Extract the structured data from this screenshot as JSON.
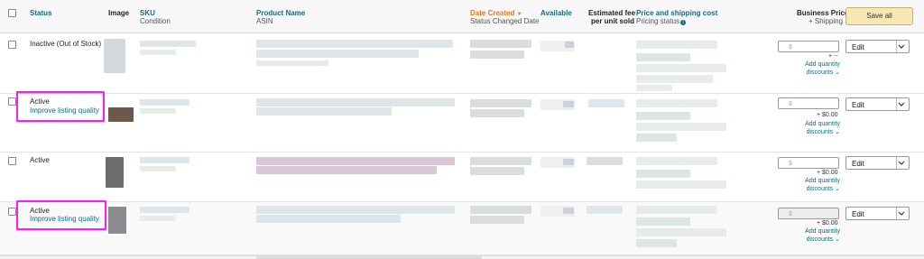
{
  "header": {
    "status": "Status",
    "image": "Image",
    "sku": "SKU",
    "condition": "Condition",
    "product_name": "Product Name",
    "asin": "ASIN",
    "date_created": "Date Created",
    "date_created_arrow": "▼",
    "status_changed_date": "Status Changed Date",
    "available": "Available",
    "est_fee_line1": "Estimated fee",
    "est_fee_line2": "per unit sold",
    "price_shipping": "Price and shipping cost",
    "pricing_status": "Pricing status",
    "pricing_status_info": "i",
    "business_price": "Business Price",
    "plus_shipping": "+ Shipping",
    "save_all": "Save all"
  },
  "rows": [
    {
      "status": "Inactive (Out of Stock)",
      "quality_link": "",
      "price_placeholder": "$",
      "shipping_text": "+ --",
      "add_discounts_line1": "Add quantity",
      "add_discounts_line2": "discounts ⌄",
      "action": "Edit"
    },
    {
      "status": "Active",
      "quality_link": "Improve listing quality",
      "price_placeholder": "$",
      "shipping_text": "+ $0.00",
      "add_discounts_line1": "Add quantity",
      "add_discounts_line2": "discounts ⌄",
      "action": "Edit"
    },
    {
      "status": "Active",
      "quality_link": "",
      "price_placeholder": "$",
      "shipping_text": "+ $0.00",
      "add_discounts_line1": "Add quantity",
      "add_discounts_line2": "discounts ⌄",
      "action": "Edit"
    },
    {
      "status": "Active",
      "quality_link": "Improve listing quality",
      "price_placeholder": "$",
      "shipping_text": "+ $0.00",
      "add_discounts_line1": "Add quantity",
      "add_discounts_line2": "discounts ⌄",
      "action": "Edit"
    }
  ],
  "colors": {
    "link_teal": "#0f6e80",
    "sort_orange": "#e47911",
    "highlight_magenta": "#ff19ff",
    "save_button": "#f6e7b4"
  },
  "icons": {
    "chevron": "chevron-down-icon",
    "info": "info-icon"
  }
}
